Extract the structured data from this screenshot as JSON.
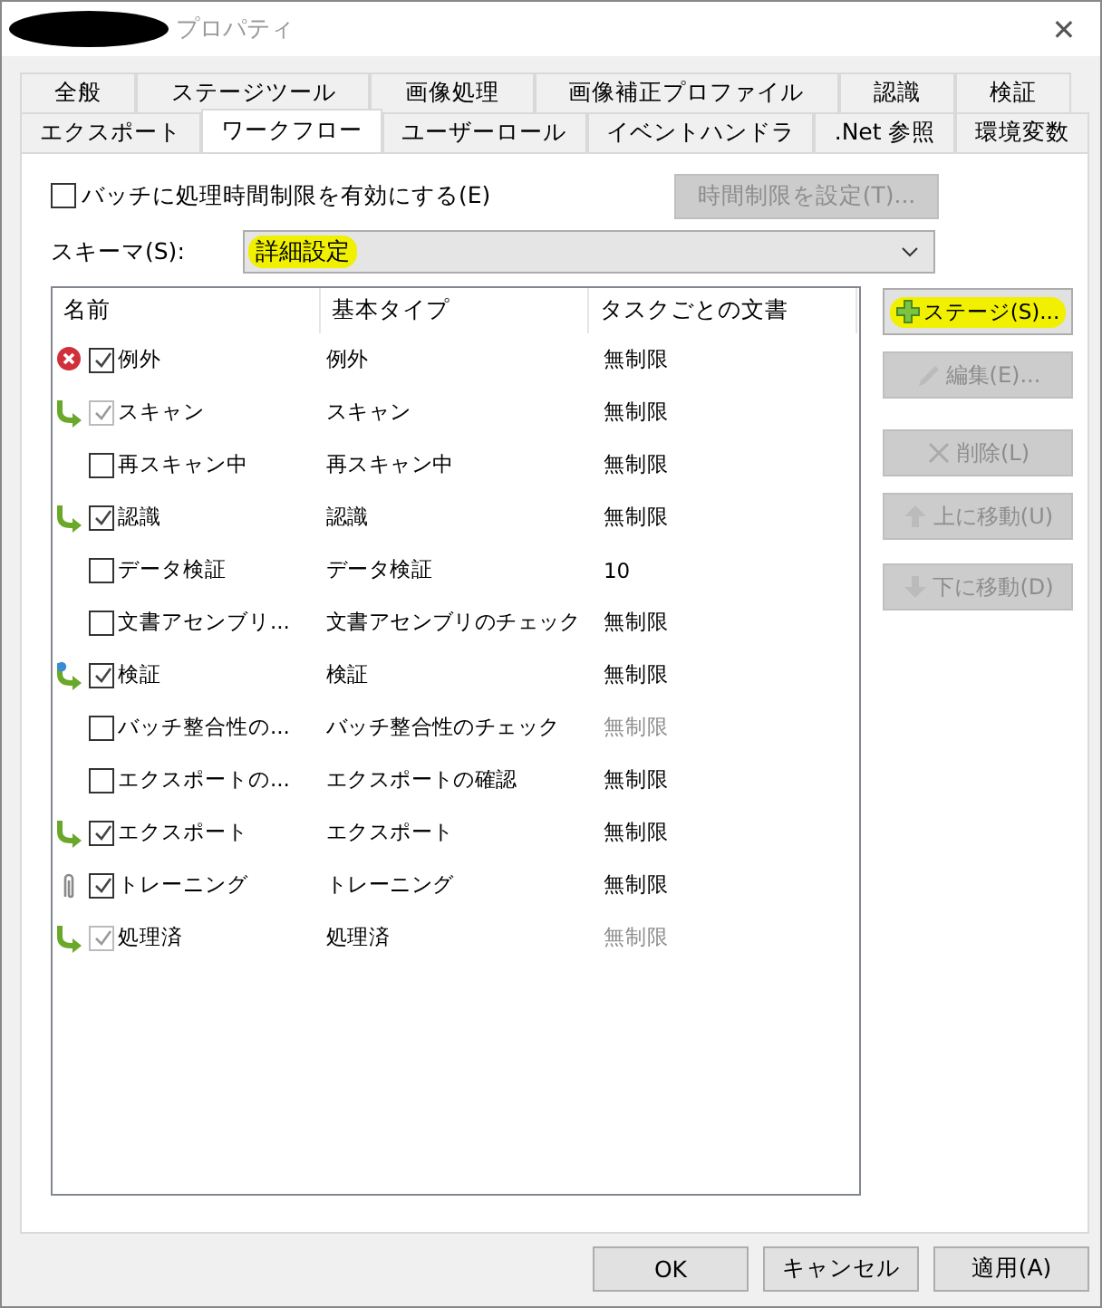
{
  "window": {
    "title": "プロパティ",
    "close": "✕"
  },
  "tab_rows": [
    [
      {
        "label": "全般",
        "selected": false
      },
      {
        "label": "ステージツール",
        "selected": false
      },
      {
        "label": "画像処理",
        "selected": false
      },
      {
        "label": "画像補正プロファイル",
        "selected": false
      },
      {
        "label": "認識",
        "selected": false
      },
      {
        "label": "検証",
        "selected": false
      }
    ],
    [
      {
        "label": "エクスポート",
        "selected": false
      },
      {
        "label": "ワークフロー",
        "selected": true
      },
      {
        "label": "ユーザーロール",
        "selected": false
      },
      {
        "label": "イベントハンドラ",
        "selected": false
      },
      {
        "label": ".Net 参照",
        "selected": false
      },
      {
        "label": "環境変数",
        "selected": false
      }
    ]
  ],
  "time_limit": {
    "label": "バッチに処理時間制限を有効にする(E)",
    "checked": false,
    "button": "時間制限を設定(T)...",
    "button_disabled": true
  },
  "schema": {
    "label": "スキーマ(S):",
    "value": "詳細設定",
    "highlighted": true
  },
  "table": {
    "columns": [
      "名前",
      "基本タイプ",
      "タスクごとの文書"
    ],
    "rows": [
      {
        "kind": "error",
        "checked": true,
        "disabled": false,
        "name": "例外",
        "type": "例外",
        "docs": "無制限",
        "docs_dim": false
      },
      {
        "kind": "arrow",
        "checked": true,
        "disabled": true,
        "name": "スキャン",
        "type": "スキャン",
        "docs": "無制限",
        "docs_dim": false
      },
      {
        "kind": "none",
        "checked": false,
        "disabled": false,
        "name": "再スキャン中",
        "type": "再スキャン中",
        "docs": "無制限",
        "docs_dim": false
      },
      {
        "kind": "arrow",
        "checked": true,
        "disabled": false,
        "name": "認識",
        "type": "認識",
        "docs": "無制限",
        "docs_dim": false
      },
      {
        "kind": "none",
        "checked": false,
        "disabled": false,
        "name": "データ検証",
        "type": "データ検証",
        "docs": "10",
        "docs_dim": false
      },
      {
        "kind": "none",
        "checked": false,
        "disabled": false,
        "name": "文書アセンブリ...",
        "type": "文書アセンブリのチェック",
        "docs": "無制限",
        "docs_dim": false
      },
      {
        "kind": "arrow-pin",
        "checked": true,
        "disabled": false,
        "name": "検証",
        "type": "検証",
        "docs": "無制限",
        "docs_dim": false
      },
      {
        "kind": "none",
        "checked": false,
        "disabled": false,
        "name": "バッチ整合性の...",
        "type": "バッチ整合性のチェック",
        "docs": "無制限",
        "docs_dim": true
      },
      {
        "kind": "none",
        "checked": false,
        "disabled": false,
        "name": "エクスポートの...",
        "type": "エクスポートの確認",
        "docs": "無制限",
        "docs_dim": false
      },
      {
        "kind": "arrow",
        "checked": true,
        "disabled": false,
        "name": "エクスポート",
        "type": "エクスポート",
        "docs": "無制限",
        "docs_dim": false
      },
      {
        "kind": "clip",
        "checked": true,
        "disabled": false,
        "name": "トレーニング",
        "type": "トレーニング",
        "docs": "無制限",
        "docs_dim": false
      },
      {
        "kind": "arrow",
        "checked": true,
        "disabled": true,
        "name": "処理済",
        "type": "処理済",
        "docs": "無制限",
        "docs_dim": true
      }
    ]
  },
  "side_buttons": [
    {
      "kind": "plus",
      "label": "ステージ(S)...",
      "disabled": false,
      "highlighted": true
    },
    {
      "kind": "pencil",
      "label": "編集(E)...",
      "disabled": true,
      "highlighted": false
    },
    {
      "kind": "cross",
      "label": "削除(L)",
      "disabled": true,
      "highlighted": false
    },
    {
      "kind": "up",
      "label": "上に移動(U)",
      "disabled": true,
      "highlighted": false
    },
    {
      "kind": "down",
      "label": "下に移動(D)",
      "disabled": true,
      "highlighted": false
    }
  ],
  "footer_buttons": [
    "OK",
    "キャンセル",
    "適用(A)"
  ]
}
